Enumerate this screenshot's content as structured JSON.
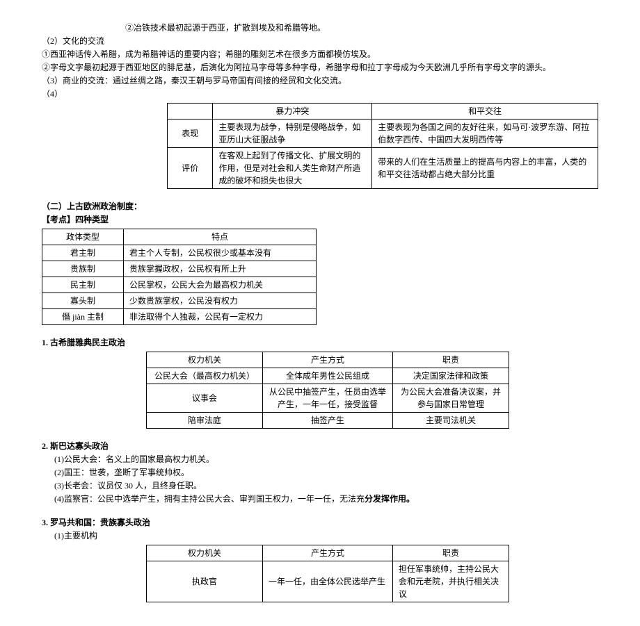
{
  "top_lines": {
    "l1": "②冶铁技术最初起源于西亚，扩散到埃及和希腊等地。",
    "l2": "（2）文化的交流",
    "l3": "①西亚神话传入希腊，成为希腊神话的重要内容；希腊的雕刻艺术在很多方面都模仿埃及。",
    "l4": "②字母文字最初起源于西亚地区的腓尼基，后演化为阿拉马字母等多种字母，希腊字母和拉丁字母成为今天欧洲几乎所有字母文字的源头。",
    "l5": "（3）商业的交流：通过丝绸之路，秦汉王朝与罗马帝国有间接的经贸和文化交流。",
    "l6": "（4）"
  },
  "table1": {
    "h1": "暴力冲突",
    "h2": "和平交往",
    "r1c0": "表现",
    "r1c1": "主要表现为战争，特别是侵略战争，如亚历山大征服战争",
    "r1c2": "主要表现为各国之间的友好往来，如马可·波罗东游、阿拉伯数字西传、中国四大发明西传等",
    "r2c0": "评价",
    "r2c1": "在客观上起到了传播文化、扩展文明的作用，但是对社会和人类生命财产所造成的破坏和损失也很大",
    "r2c2": "带来的人们在生活质量上的提高与内容上的丰富，人类的和平交往活动都占绝大部分比重"
  },
  "sec2_title": "（二）上古欧洲政治制度：",
  "kaodian_label": "【考点】四种类型",
  "table2": {
    "h1": "政体类型",
    "h2": "特点",
    "rows": [
      {
        "c1": "君主制",
        "c2": "君主个人专制，公民权很少或基本没有"
      },
      {
        "c1": "贵族制",
        "c2": "贵族掌握政权，公民权有所上升"
      },
      {
        "c1": "民主制",
        "c2": "公民掌权，公民大会为最高权力机关"
      },
      {
        "c1": "寡头制",
        "c2": "少数贵族掌权，公民没有权力"
      },
      {
        "c1": "僭 jiàn 主制",
        "c2": "非法取得个人独裁，公民有一定权力"
      }
    ]
  },
  "h1_title": "1. 古希腊雅典民主政治",
  "table3": {
    "h1": "权力机关",
    "h2": "产生方式",
    "h3": "职责",
    "rows": [
      {
        "c1": "公民大会（最高权力机关）",
        "c2": "全体成年男性公民组成",
        "c3": "决定国家法律和政策"
      },
      {
        "c1": "议事会",
        "c2": "从公民中抽签产生，任员由选举产生，一年一任，接受监督",
        "c3": "为公民大会准备决议案，并参与国家日常管理"
      },
      {
        "c1": "陪审法庭",
        "c2": "抽签产生",
        "c3": "主要司法机关"
      }
    ]
  },
  "h2_title": "2. 斯巴达寡头政治",
  "h2_lines": {
    "l1": "(1)公民大会：名义上的国家最高权力机关。",
    "l2": "(2)国王：世袭，垄断了军事统帅权。",
    "l3": "(3)长老会：议员仅 30 人，且终身任职。",
    "l4a": "(4)监察官：公民中选举产生，拥有主持公民大会、审判国王权力，一年一任，无法充",
    "l4b": "分发挥作用。"
  },
  "h3_title": "3. 罗马共和国：贵族寡头政治",
  "h3_sub": "(1)主要机构",
  "table4": {
    "h1": "权力机关",
    "h2": "产生方式",
    "h3": "职责",
    "r1c1": "执政官",
    "r1c2": "一年一任，由全体公民选举产生",
    "r1c3": "担任军事统帅，主持公民大会和元老院，并执行相关决议"
  }
}
